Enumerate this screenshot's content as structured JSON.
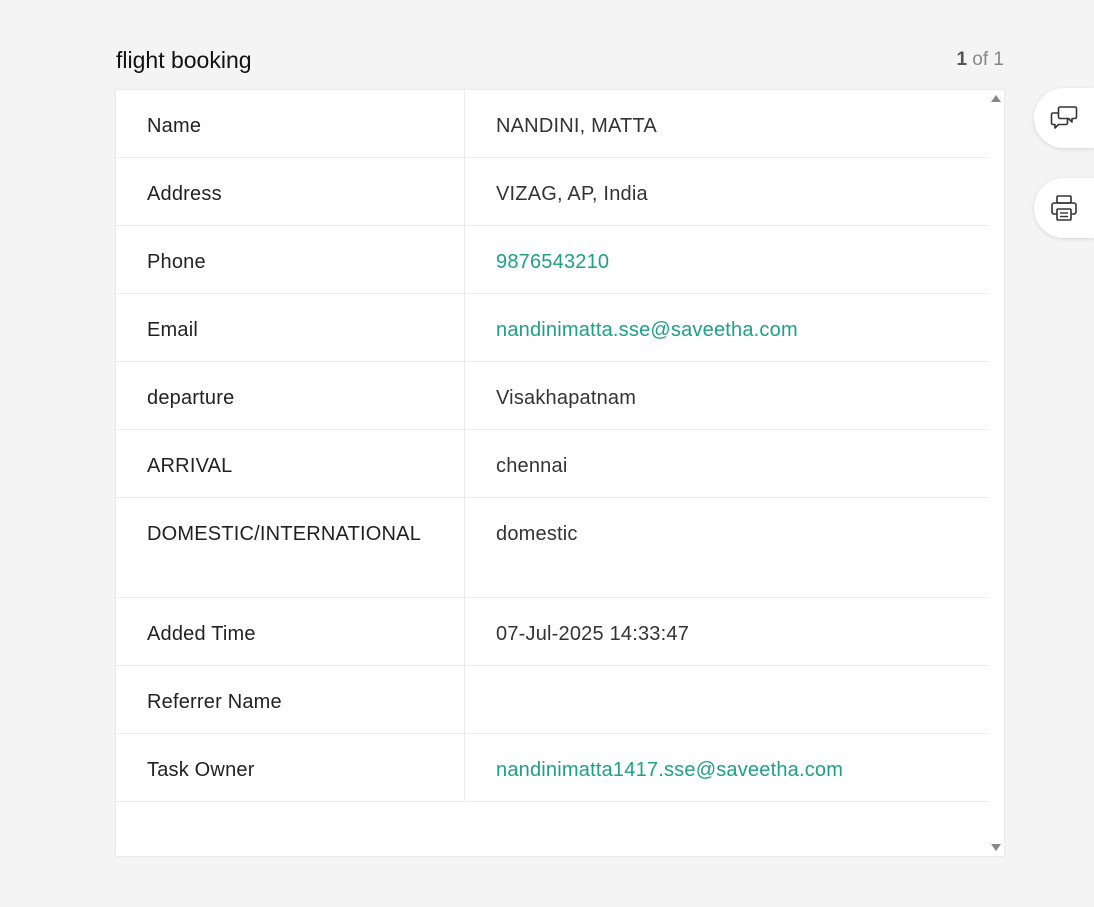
{
  "form": {
    "title": "flight booking",
    "pager": {
      "current": "1",
      "of_label": "of 1"
    }
  },
  "record": {
    "rows": [
      {
        "label": "Name",
        "value": "NANDINI, MATTA"
      },
      {
        "label": "Address",
        "value": "VIZAG, AP, India"
      },
      {
        "label": "Phone",
        "value": "9876543210"
      },
      {
        "label": "Email",
        "value": "nandinimatta.sse@saveetha.com"
      },
      {
        "label": "departure",
        "value": "Visakhapatnam"
      },
      {
        "label": "ARRIVAL",
        "value": "chennai"
      },
      {
        "label": "DOMESTIC/INTERNATIONAL",
        "value": "domestic"
      },
      {
        "label": "Added Time",
        "value": "07-Jul-2025 14:33:47"
      },
      {
        "label": "Referrer Name",
        "value": ""
      },
      {
        "label": "Task Owner",
        "value": "nandinimatta1417.sse@saveetha.com"
      }
    ]
  },
  "side_actions": {
    "comments_icon": "comments-icon",
    "print_icon": "printer-icon"
  },
  "colors": {
    "background": "#f4f4f4",
    "link": "#1fa085",
    "card": "#ffffff"
  }
}
